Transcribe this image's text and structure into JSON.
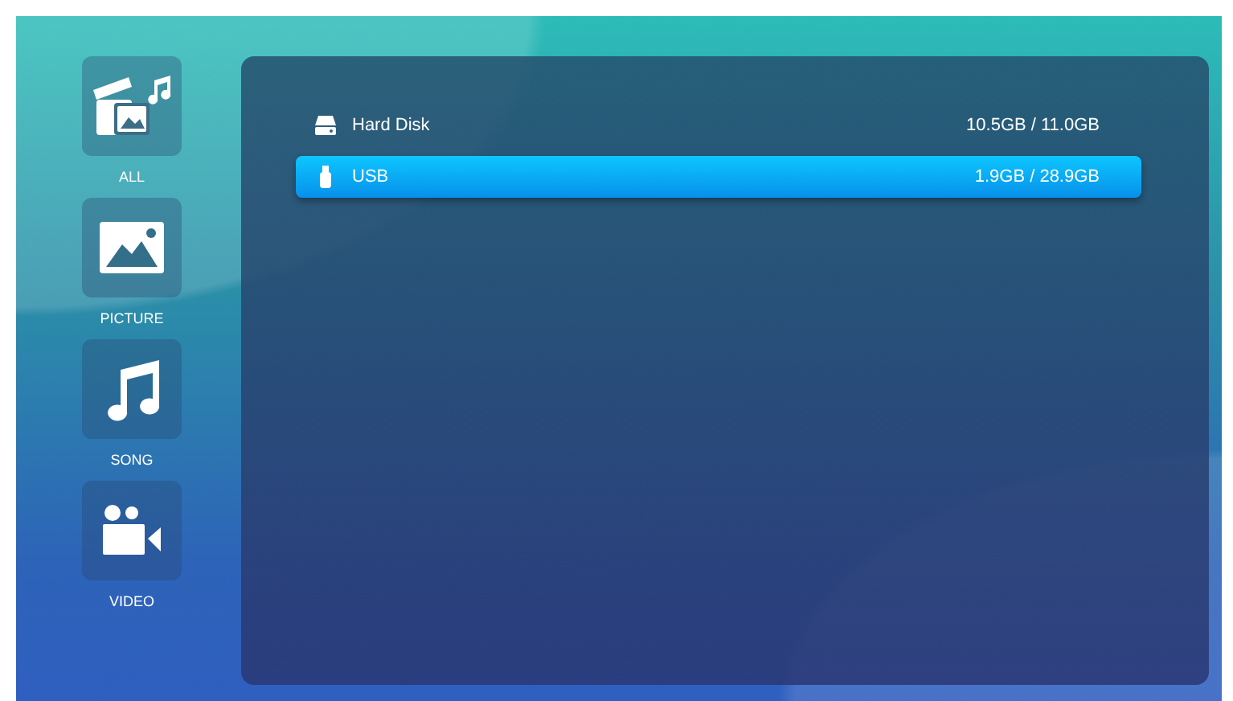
{
  "sidebar": {
    "items": [
      {
        "kind": "all",
        "label": "ALL"
      },
      {
        "kind": "picture",
        "label": "PICTURE"
      },
      {
        "kind": "song",
        "label": "SONG"
      },
      {
        "kind": "video",
        "label": "VIDEO"
      }
    ]
  },
  "devices": [
    {
      "kind": "disk",
      "name": "Hard Disk",
      "usage": "10.5GB / 11.0GB",
      "selected": false
    },
    {
      "kind": "usb",
      "name": "USB",
      "usage": "1.9GB / 28.9GB",
      "selected": true
    }
  ]
}
